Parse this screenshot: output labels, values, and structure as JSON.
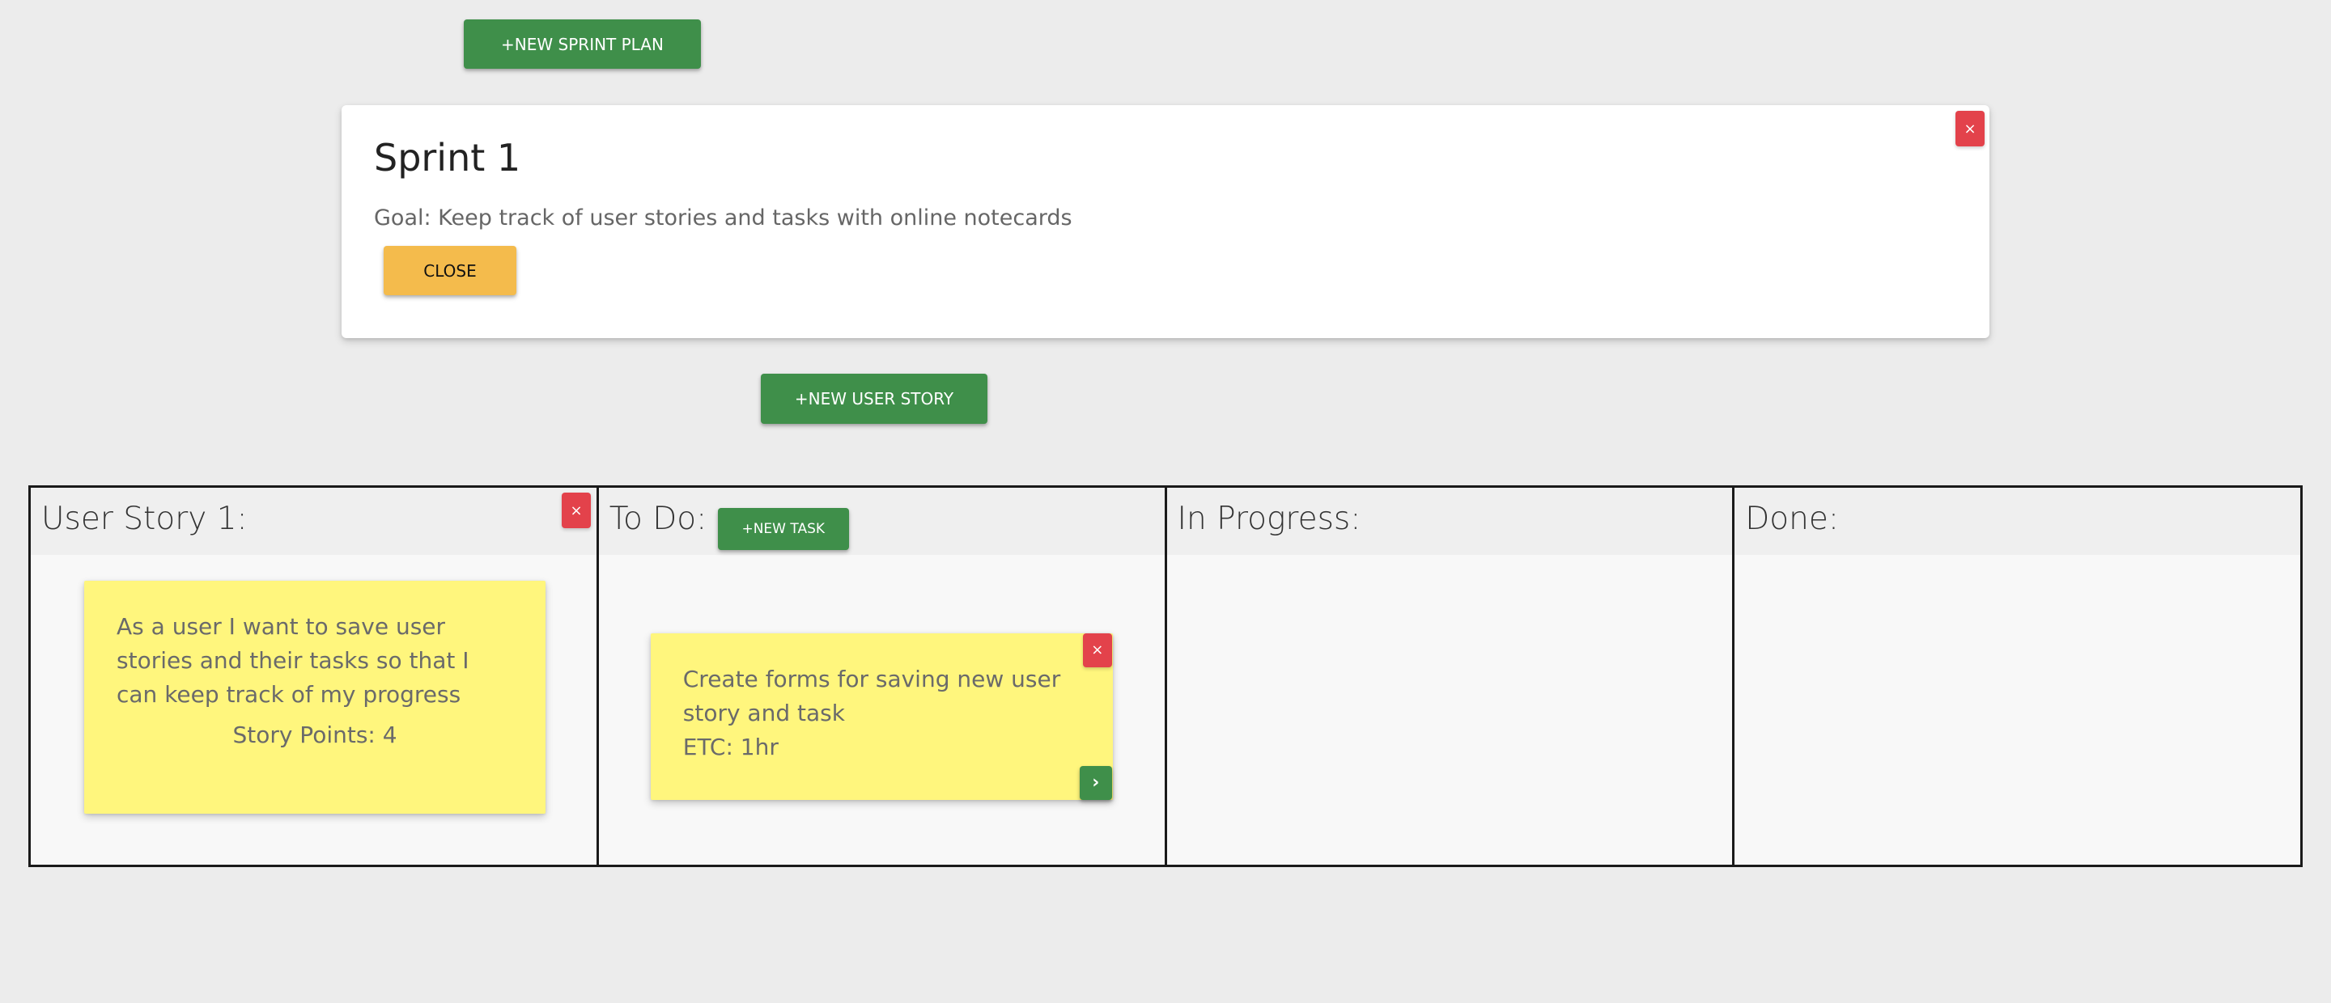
{
  "toolbar": {
    "new_sprint_label": "+NEW SPRINT PLAN",
    "new_story_label": "+NEW USER STORY"
  },
  "sprint": {
    "title": "Sprint 1",
    "goal": "Goal: Keep track of user stories and tasks with online notecards",
    "close_label": "CLOSE",
    "delete_label": "×"
  },
  "board": {
    "columns": [
      {
        "title": "User Story 1:"
      },
      {
        "title": "To Do:"
      },
      {
        "title": "In Progress:"
      },
      {
        "title": "Done:"
      }
    ],
    "new_task_label": "+NEW TASK",
    "story": {
      "text": "As a user I want to save user stories and their tasks so that I can keep track of my progress",
      "points": "Story Points: 4",
      "delete_label": "×"
    },
    "task": {
      "text": "Create forms for saving new user story and task",
      "etc": "ETC: 1hr",
      "delete_label": "×",
      "move_label": "›"
    }
  },
  "colors": {
    "background": "#ececec",
    "green": "#3f8f4a",
    "amber": "#f4bb4c",
    "red": "#e3424b",
    "sticky_yellow": "#fff67d"
  }
}
